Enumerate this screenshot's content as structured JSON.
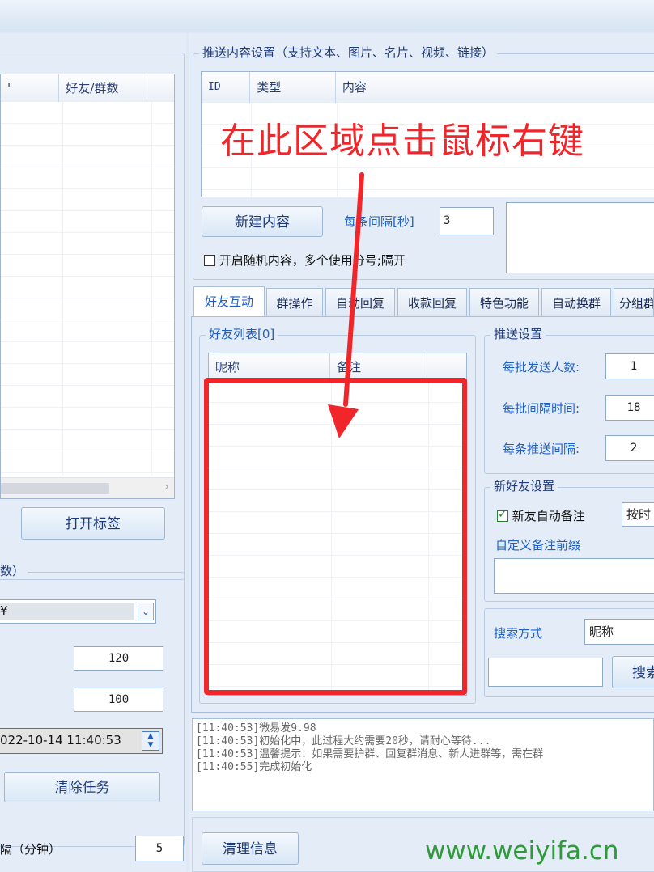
{
  "left": {
    "group_header_partial": "数）",
    "friends_group_column": "好友/群数",
    "first_column_partial": "'",
    "open_tags_button": "打开标签",
    "combo_value_partial": "¥",
    "value_1": "120",
    "value_2": "100",
    "datetime": "022-10-14 11:40:53",
    "clear_tasks_button": "清除任务",
    "interval_label_partial": "隔（分钟）",
    "interval_value": "5"
  },
  "push": {
    "group_title": "推送内容设置（支持文本、图片、名片、视频、链接）",
    "columns": [
      "ID",
      "类型",
      "内容"
    ],
    "new_content_button": "新建内容",
    "interval_label": "每条间隔[秒]",
    "interval_value": "3",
    "random_label": "开启随机内容，多个使用分号;隔开"
  },
  "annotation": {
    "text": "在此区域点击鼠标右键"
  },
  "tabs": [
    "好友互动",
    "群操作",
    "自动回复",
    "收款回复",
    "特色功能",
    "自动换群",
    "分组群"
  ],
  "friends": {
    "title": "好友列表[0]",
    "columns": [
      "昵称",
      "备注"
    ]
  },
  "send_settings": {
    "title": "推送设置",
    "per_batch_label": "每批发送人数:",
    "per_batch_value": "1",
    "batch_interval_label": "每批间隔时间:",
    "batch_interval_value": "18",
    "item_interval_label": "每条推送间隔:",
    "item_interval_value": "2"
  },
  "new_friend": {
    "title": "新好友设置",
    "auto_remark_label": "新友自动备注",
    "auto_remark_checked": true,
    "by_time_partial": "按时",
    "custom_prefix_label": "自定义备注前缀"
  },
  "search": {
    "mode_label": "搜索方式",
    "mode_value": "昵称",
    "button_partial": "搜索"
  },
  "log": {
    "lines": [
      "[11:40:53]微易发9.98",
      "[11:40:53]初始化中，此过程大约需要20秒，请耐心等待...",
      "[11:40:53]温馨提示：如果需要护群、回复群消息、新人进群等，需在群",
      "[11:40:55]完成初始化"
    ]
  },
  "bottom": {
    "clear_info_button": "清理信息",
    "watermark": "www.weiyifa.cn"
  },
  "colors": {
    "annotation_red": "#f0262a",
    "accent_blue": "#1f5fc4",
    "watermark_green": "#2e9a3a"
  }
}
